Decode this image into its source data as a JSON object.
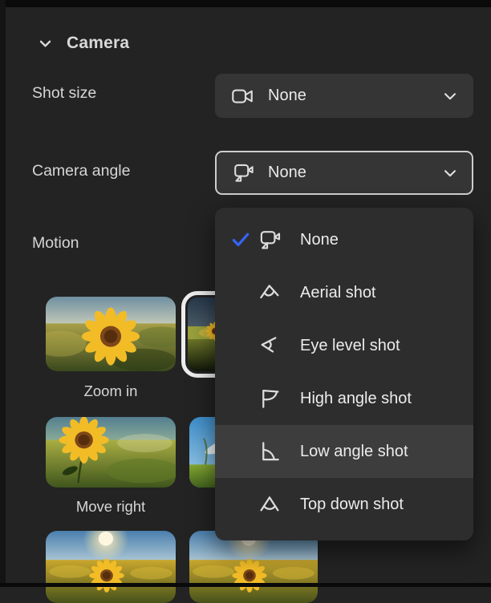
{
  "camera_section": {
    "title": "Camera"
  },
  "fields": [
    {
      "label": "Shot size",
      "value": "None"
    },
    {
      "label": "Camera angle",
      "value": "None"
    }
  ],
  "motion": {
    "label": "Motion",
    "options": [
      {
        "label": "Zoom in",
        "selected": false
      },
      {
        "label": "",
        "selected": true
      },
      {
        "label": "Move right",
        "selected": false
      }
    ]
  },
  "dropdown_menu": {
    "items": [
      {
        "label": "None",
        "selected": true,
        "highlighted": false
      },
      {
        "label": "Aerial shot",
        "selected": false,
        "highlighted": false
      },
      {
        "label": "Eye level shot",
        "selected": false,
        "highlighted": false
      },
      {
        "label": "High angle shot",
        "selected": false,
        "highlighted": false
      },
      {
        "label": "Low angle shot",
        "selected": false,
        "highlighted": true
      },
      {
        "label": "Top down shot",
        "selected": false,
        "highlighted": false
      }
    ]
  },
  "icons": {
    "section_chevron": "chevron-down-icon",
    "shot_size": "video-camera-icon",
    "camera_angle": "camera-angle-icon",
    "dropdown_chevron": "chevron-down-icon",
    "selected_check": "check-icon",
    "menu_item_icons": [
      "camera-angle-icon",
      "aerial-shot-icon",
      "eye-level-shot-icon",
      "high-angle-shot-icon",
      "low-angle-shot-icon",
      "top-down-shot-icon"
    ]
  },
  "colors": {
    "panel_bg": "#232323",
    "control_bg": "#353535",
    "menu_bg": "#2d2d2d",
    "menu_highlight": "#3d3d3d",
    "focus_border": "#cdcdcd",
    "check_blue": "#3564f4",
    "selection_ring": "#ededed",
    "text": "#ececec"
  }
}
